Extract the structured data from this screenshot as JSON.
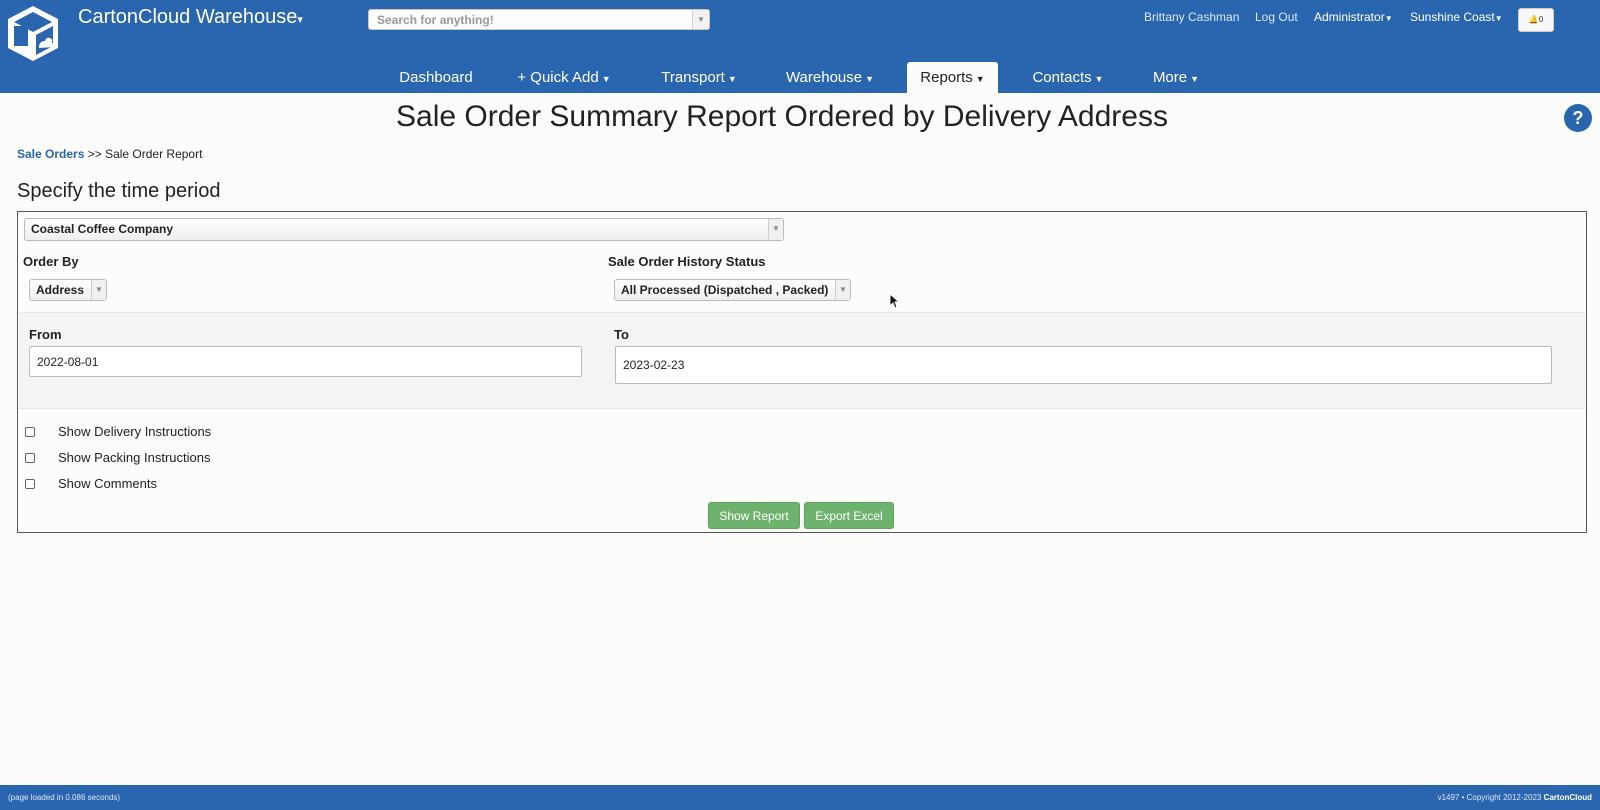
{
  "app": {
    "title": "CartonCloud Warehouse",
    "title_caret": "▾"
  },
  "search": {
    "placeholder": "Search for anything!"
  },
  "header": {
    "user": "Brittany Cashman",
    "logout": "Log Out",
    "role": "Administrator",
    "location": "Sunshine Coast",
    "notifications_count": "0"
  },
  "nav": {
    "dashboard": "Dashboard",
    "quick_add": "+ Quick Add",
    "transport": "Transport",
    "warehouse": "Warehouse",
    "reports": "Reports",
    "contacts": "Contacts",
    "more": "More"
  },
  "page": {
    "title": "Sale Order Summary Report Ordered by Delivery Address",
    "help": "?"
  },
  "breadcrumb": {
    "link": "Sale Orders",
    "separator": " >> ",
    "current": "Sale Order Report"
  },
  "form": {
    "section_title": "Specify the time period",
    "customer_value": "Coastal Coffee Company",
    "order_by_label": "Order By",
    "order_by_value": "Address",
    "status_label": "Sale Order History Status",
    "status_value": "All Processed (Dispatched , Packed)",
    "from_label": "From",
    "from_value": "2022-08-01",
    "to_label": "To",
    "to_value": "2023-02-23",
    "checkboxes": [
      {
        "label": "Show Delivery Instructions",
        "checked": false
      },
      {
        "label": "Show Packing Instructions",
        "checked": false
      },
      {
        "label": "Show Comments",
        "checked": false
      }
    ],
    "show_report": "Show Report",
    "export_excel": "Export Excel"
  },
  "footer": {
    "load_time": "(page loaded in 0.086 seconds)",
    "copyright": "v1497 • Copyright 2012-2023 ",
    "brand": "CartonCloud"
  },
  "colors": {
    "primary": "#2a66b0",
    "button_green": "#6db36d"
  },
  "icons": [
    "cartoncloud-logo-icon",
    "chevron-down-icon",
    "bell-icon",
    "help-icon",
    "mouse-cursor-icon"
  ]
}
